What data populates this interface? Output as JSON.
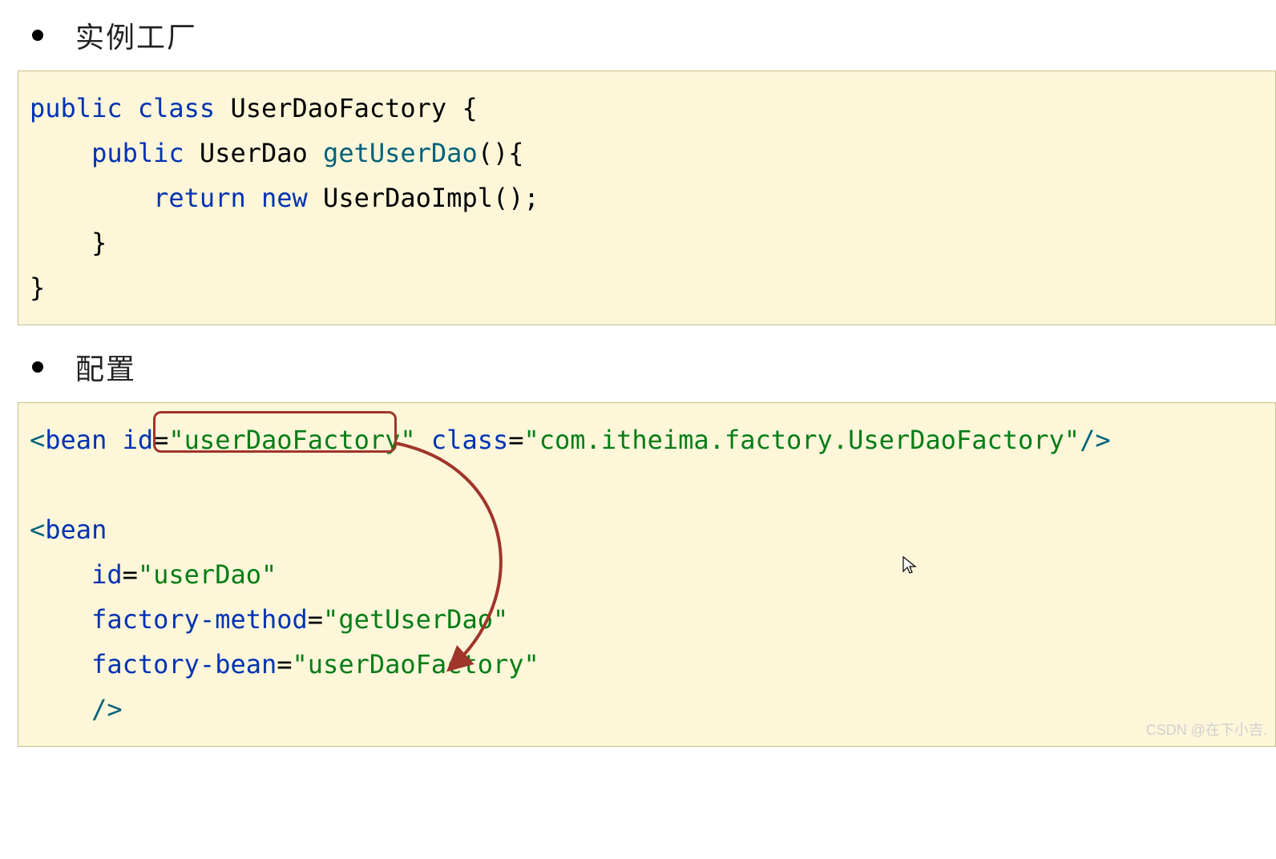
{
  "headers": {
    "h1": "实例工厂",
    "h2": "配置"
  },
  "java_code": {
    "tokens": [
      {
        "t": "public",
        "c": "kw"
      },
      {
        "t": " ",
        "c": "plain"
      },
      {
        "t": "class",
        "c": "kw"
      },
      {
        "t": " UserDaoFactory {",
        "c": "plain"
      },
      {
        "t": "\n",
        "c": "plain"
      },
      {
        "t": "    ",
        "c": "plain"
      },
      {
        "t": "public",
        "c": "kw"
      },
      {
        "t": " UserDao ",
        "c": "plain"
      },
      {
        "t": "getUserDao",
        "c": "method"
      },
      {
        "t": "(){",
        "c": "plain"
      },
      {
        "t": "\n",
        "c": "plain"
      },
      {
        "t": "        ",
        "c": "plain"
      },
      {
        "t": "return",
        "c": "kw"
      },
      {
        "t": " ",
        "c": "plain"
      },
      {
        "t": "new",
        "c": "kw"
      },
      {
        "t": " UserDaoImpl();",
        "c": "plain"
      },
      {
        "t": "\n",
        "c": "plain"
      },
      {
        "t": "    }",
        "c": "plain"
      },
      {
        "t": "\n",
        "c": "plain"
      },
      {
        "t": "}",
        "c": "plain"
      }
    ]
  },
  "xml_code": {
    "tokens": [
      {
        "t": "<",
        "c": "tag-bracket"
      },
      {
        "t": "bean ",
        "c": "tag-name"
      },
      {
        "t": "id",
        "c": "attr-name"
      },
      {
        "t": "=",
        "c": "attr-eq"
      },
      {
        "t": "\"userDaoFactory\"",
        "c": "attr-val"
      },
      {
        "t": " ",
        "c": "plain"
      },
      {
        "t": "class",
        "c": "attr-name"
      },
      {
        "t": "=",
        "c": "attr-eq"
      },
      {
        "t": "\"com.itheima.factory.UserDaoFactory\"",
        "c": "attr-val"
      },
      {
        "t": "/>",
        "c": "tag-bracket"
      },
      {
        "t": "\n",
        "c": "plain"
      },
      {
        "t": "\n",
        "c": "plain"
      },
      {
        "t": "<",
        "c": "tag-bracket"
      },
      {
        "t": "bean",
        "c": "tag-name"
      },
      {
        "t": "\n",
        "c": "plain"
      },
      {
        "t": "    ",
        "c": "plain"
      },
      {
        "t": "id",
        "c": "attr-name"
      },
      {
        "t": "=",
        "c": "attr-eq"
      },
      {
        "t": "\"userDao\"",
        "c": "attr-val"
      },
      {
        "t": "\n",
        "c": "plain"
      },
      {
        "t": "    ",
        "c": "plain"
      },
      {
        "t": "factory-method",
        "c": "attr-name"
      },
      {
        "t": "=",
        "c": "attr-eq"
      },
      {
        "t": "\"getUserDao\"",
        "c": "attr-val"
      },
      {
        "t": "\n",
        "c": "plain"
      },
      {
        "t": "    ",
        "c": "plain"
      },
      {
        "t": "factory-bean",
        "c": "attr-name"
      },
      {
        "t": "=",
        "c": "attr-eq"
      },
      {
        "t": "\"userDaoFactory\"",
        "c": "attr-val"
      },
      {
        "t": "\n",
        "c": "plain"
      },
      {
        "t": "    ",
        "c": "plain"
      },
      {
        "t": "/>",
        "c": "tag-bracket"
      }
    ]
  },
  "annotations": {
    "highlight_target": "\"userDaoFactory\"",
    "arrow_from": "userDaoFactory (bean id)",
    "arrow_to": "userDaoFactory (factory-bean)"
  },
  "watermark": "CSDN @在下小吉."
}
